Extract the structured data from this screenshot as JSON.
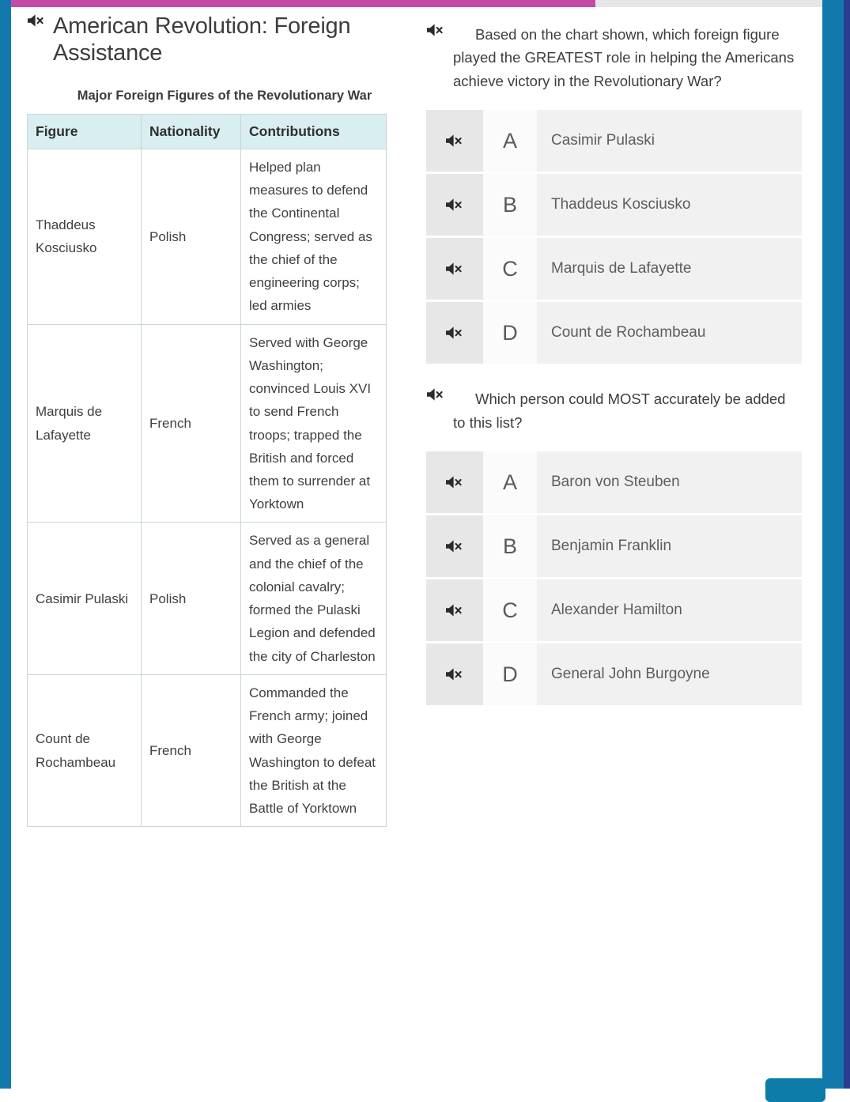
{
  "chrome": {
    "progress_percent": 72,
    "accent_magenta": "#c34aa6",
    "rail_blue": "#1179ac",
    "rail_edge_navy": "#2b3b8f",
    "next_button_label": ""
  },
  "lesson": {
    "title": "American Revolution: Foreign Assistance",
    "speaker_icon": "muted-speaker-icon"
  },
  "table": {
    "caption": "Major Foreign Figures of the Revolutionary War",
    "header_background": "#d9eef1",
    "columns": [
      "Figure",
      "Nationality",
      "Contributions"
    ],
    "rows": [
      {
        "figure": "Thaddeus Kosciusko",
        "nationality": "Polish",
        "contributions": "Helped plan measures to defend the Continental Congress; served as the chief of the engineering corps; led armies"
      },
      {
        "figure": "Marquis de Lafayette",
        "nationality": "French",
        "contributions": "Served with George Washington; convinced Louis XVI to send French troops; trapped the British and forced them to surrender at Yorktown"
      },
      {
        "figure": "Casimir Pulaski",
        "nationality": "Polish",
        "contributions": "Served as a general and the chief of the colonial cavalry; formed the Pulaski Legion and defended the city of Charleston"
      },
      {
        "figure": "Count de Rochambeau",
        "nationality": "French",
        "contributions": "Commanded the French army; joined with George Washington to defeat the British at the Battle of Yorktown"
      }
    ]
  },
  "questions": [
    {
      "prompt": "Based on the chart shown, which foreign figure played the GREATEST role in helping the Americans achieve victory in the Revolutionary War?",
      "speaker_icon": "muted-speaker-icon",
      "options": [
        {
          "letter": "A",
          "label": "Casimir Pulaski"
        },
        {
          "letter": "B",
          "label": "Thaddeus Kosciusko"
        },
        {
          "letter": "C",
          "label": "Marquis de Lafayette"
        },
        {
          "letter": "D",
          "label": "Count de Rochambeau"
        }
      ]
    },
    {
      "prompt": "Which person could MOST accurately be added to this list?",
      "speaker_icon": "muted-speaker-icon",
      "options": [
        {
          "letter": "A",
          "label": "Baron von Steuben"
        },
        {
          "letter": "B",
          "label": "Benjamin Franklin"
        },
        {
          "letter": "C",
          "label": "Alexander Hamilton"
        },
        {
          "letter": "D",
          "label": "General John Burgoyne"
        }
      ]
    }
  ]
}
